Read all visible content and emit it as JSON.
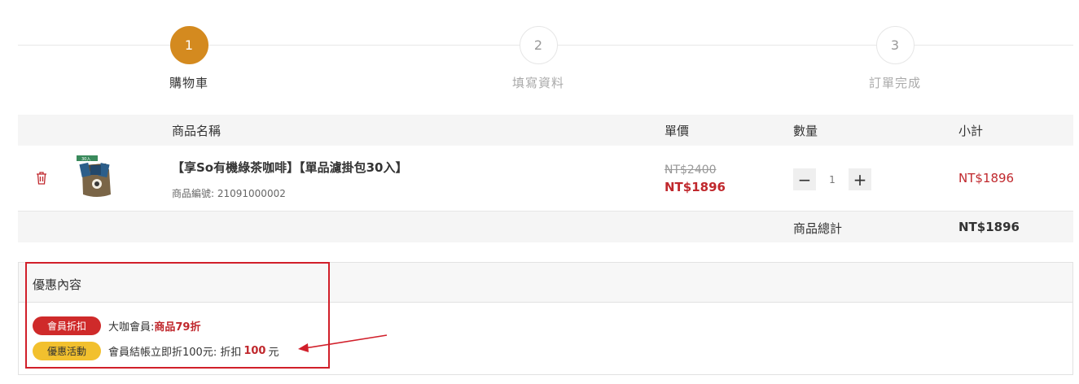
{
  "steps": [
    {
      "number": "1",
      "label": "購物車",
      "active": true
    },
    {
      "number": "2",
      "label": "填寫資料",
      "active": false
    },
    {
      "number": "3",
      "label": "訂單完成",
      "active": false
    }
  ],
  "cart": {
    "columns": {
      "name": "商品名稱",
      "unit_price": "單價",
      "quantity": "數量",
      "subtotal": "小計"
    },
    "items": [
      {
        "name": "【享So有機綠茶咖啡】【單品濾掛包30入】",
        "code_label": "商品編號: ",
        "code": "21091000002",
        "original_price": "NT$2400",
        "price": "NT$1896",
        "quantity": "1",
        "subtotal": "NT$1896",
        "thumb_label": "30入"
      }
    ],
    "total_label": "商品總計",
    "total_value": "NT$1896"
  },
  "promotions": {
    "title": "優惠內容",
    "items": [
      {
        "badge": "會員折扣",
        "badge_color": "#cf2a2a",
        "text": "大咖會員: ",
        "highlight": "商品79折",
        "suffix": ""
      },
      {
        "badge": "優惠活動",
        "badge_color": "#f2c02e",
        "text": "會員結帳立即折100元: 折扣 ",
        "highlight": "100",
        "suffix": " 元"
      }
    ]
  },
  "colors": {
    "accent": "#d48a1f",
    "price_red": "#c0282d",
    "annotation_red": "#d11f2a"
  },
  "icons": {
    "delete": "trash-icon",
    "minus": "minus-icon",
    "plus": "plus-icon"
  }
}
